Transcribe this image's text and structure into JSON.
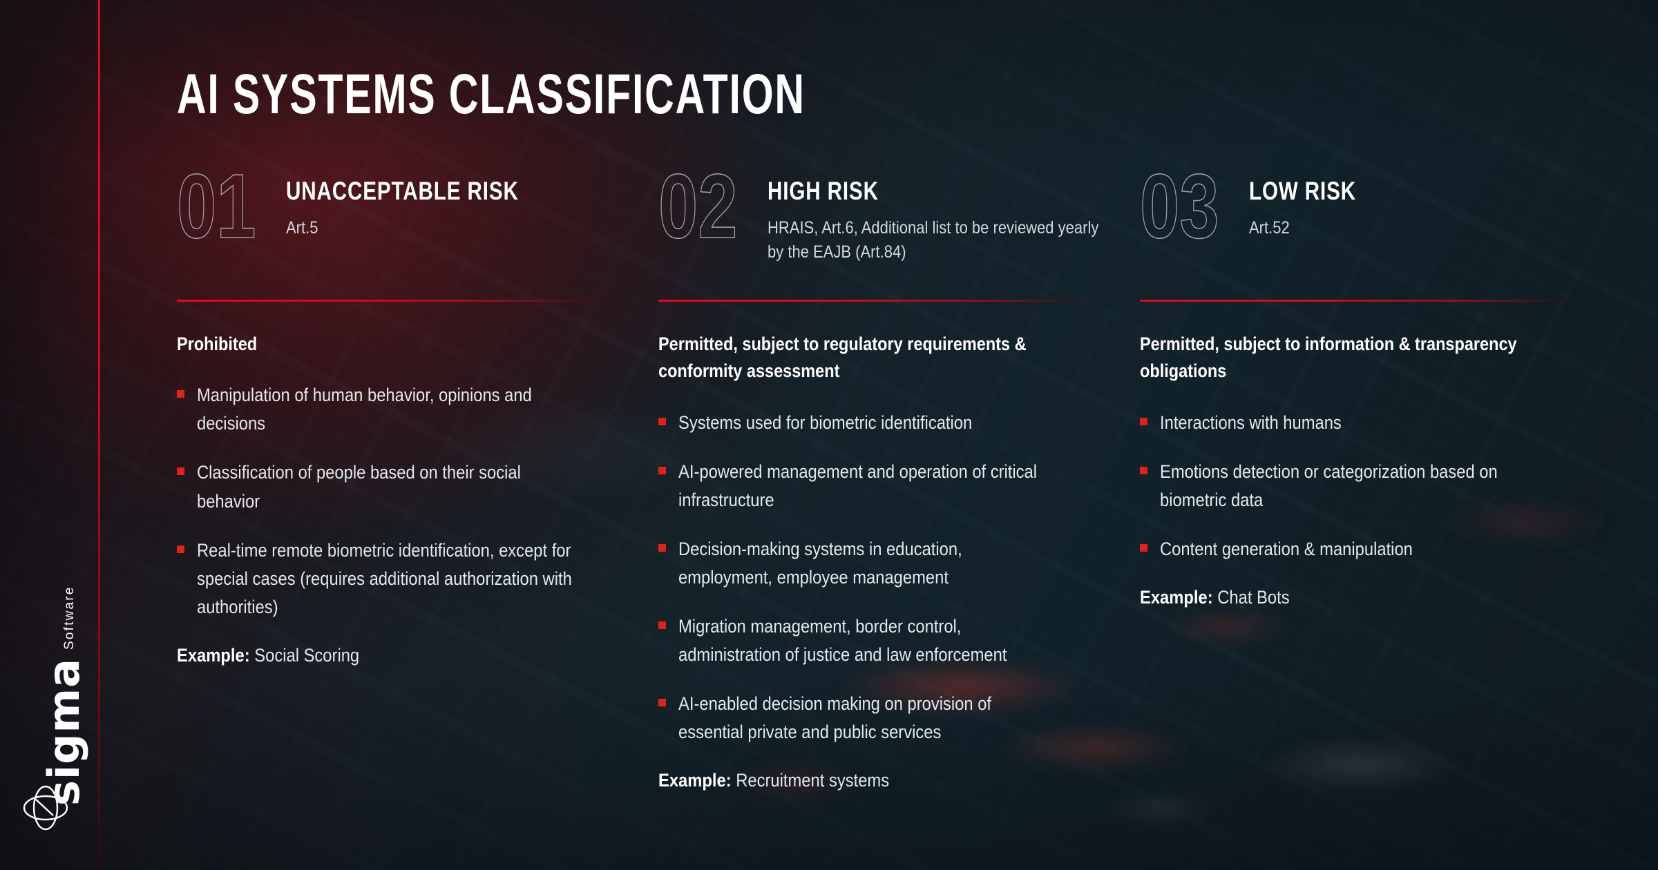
{
  "slide": {
    "title": "AI SYSTEMS CLASSIFICATION",
    "accent_red": "#e0081c",
    "bullet_red": "#e32119",
    "background_dark": "#101d23"
  },
  "logo": {
    "name": "sigma",
    "subtitle": "Software",
    "mark": "orbit-atom-icon"
  },
  "columns": [
    {
      "number": "01",
      "title": "UNACCEPTABLE RISK",
      "reference": "Art.5",
      "lead": "Prohibited",
      "bullets": [
        "Manipulation of human behavior, opinions and decisions",
        "Classification of people based on their social behavior",
        "Real-time remote biometric identification, except for special cases (requires additional authorization with authorities)"
      ],
      "example_label": "Example:",
      "example_value": "Social Scoring"
    },
    {
      "number": "02",
      "title": "HIGH RISK",
      "reference": "HRAIS, Art.6, Additional list to be reviewed yearly by the EAJB (Art.84)",
      "lead": "Permitted, subject to regulatory requirements & conformity assessment",
      "bullets": [
        "Systems used for biometric identification",
        "AI-powered management and operation of critical infrastructure",
        "Decision-making systems in education, employment, employee management",
        "Migration management, border control, administration of justice and law enforcement",
        "AI-enabled decision making on provision of essential private and public services"
      ],
      "example_label": "Example:",
      "example_value": "Recruitment systems"
    },
    {
      "number": "03",
      "title": "LOW RISK",
      "reference": "Art.52",
      "lead": "Permitted, subject to information & transparency obligations",
      "bullets": [
        "Interactions with humans",
        "Emotions detection or categorization based on biometric data",
        "Content generation & manipulation"
      ],
      "example_label": "Example:",
      "example_value": "Chat Bots"
    }
  ]
}
